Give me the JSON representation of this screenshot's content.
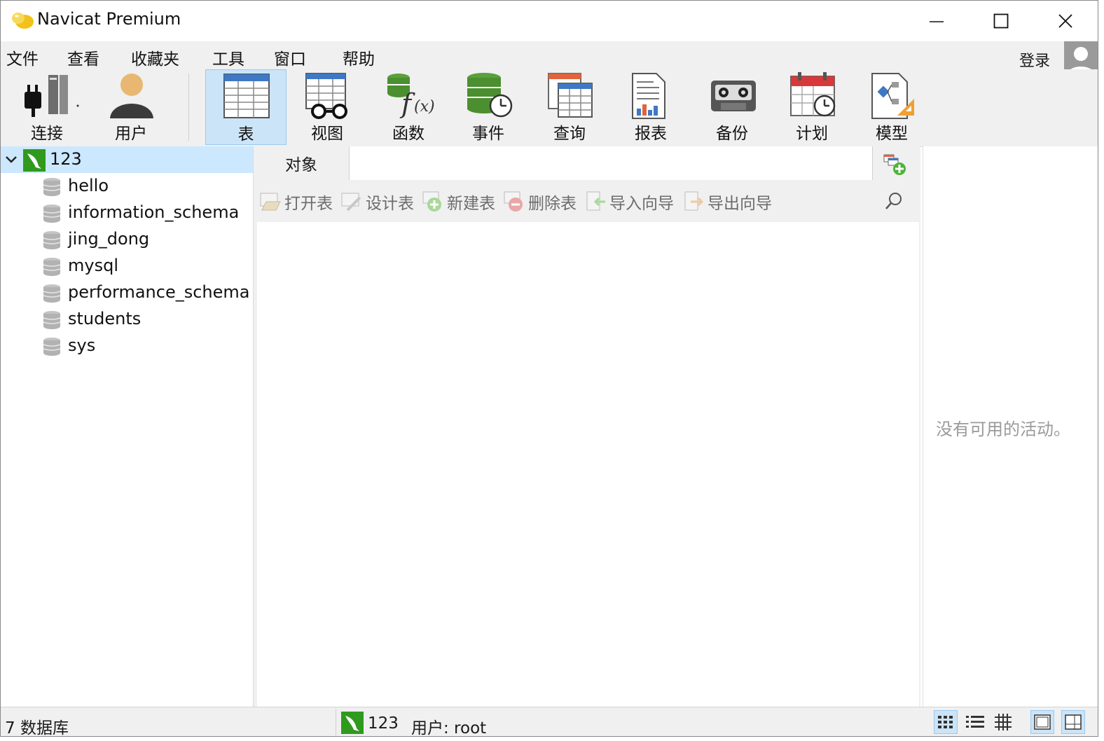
{
  "window": {
    "title": "Navicat Premium"
  },
  "menu": [
    "文件",
    "查看",
    "收藏夹",
    "工具",
    "窗口",
    "帮助"
  ],
  "login_label": "登录",
  "toolbar": {
    "connect": "连接",
    "user": "用户",
    "table": "表",
    "view": "视图",
    "function": "函数",
    "event": "事件",
    "query": "查询",
    "report": "报表",
    "backup": "备份",
    "schedule": "计划",
    "model": "模型"
  },
  "tree": {
    "connection": "123",
    "databases": [
      "hello",
      "information_schema",
      "jing_dong",
      "mysql",
      "performance_schema",
      "students",
      "sys"
    ]
  },
  "tabs": {
    "object": "对象"
  },
  "object_toolbar": {
    "open": "打开表",
    "design": "设计表",
    "new": "新建表",
    "delete": "删除表",
    "import": "导入向导",
    "export": "导出向导"
  },
  "right_panel": {
    "empty": "没有可用的活动。"
  },
  "status": {
    "db_count": "7 数据库",
    "connection": "123",
    "user": "用户: root"
  },
  "colors": {
    "selection": "#cce8ff",
    "accent_green": "#3a9a2a",
    "toolbar_bg": "#f0f0f0"
  }
}
